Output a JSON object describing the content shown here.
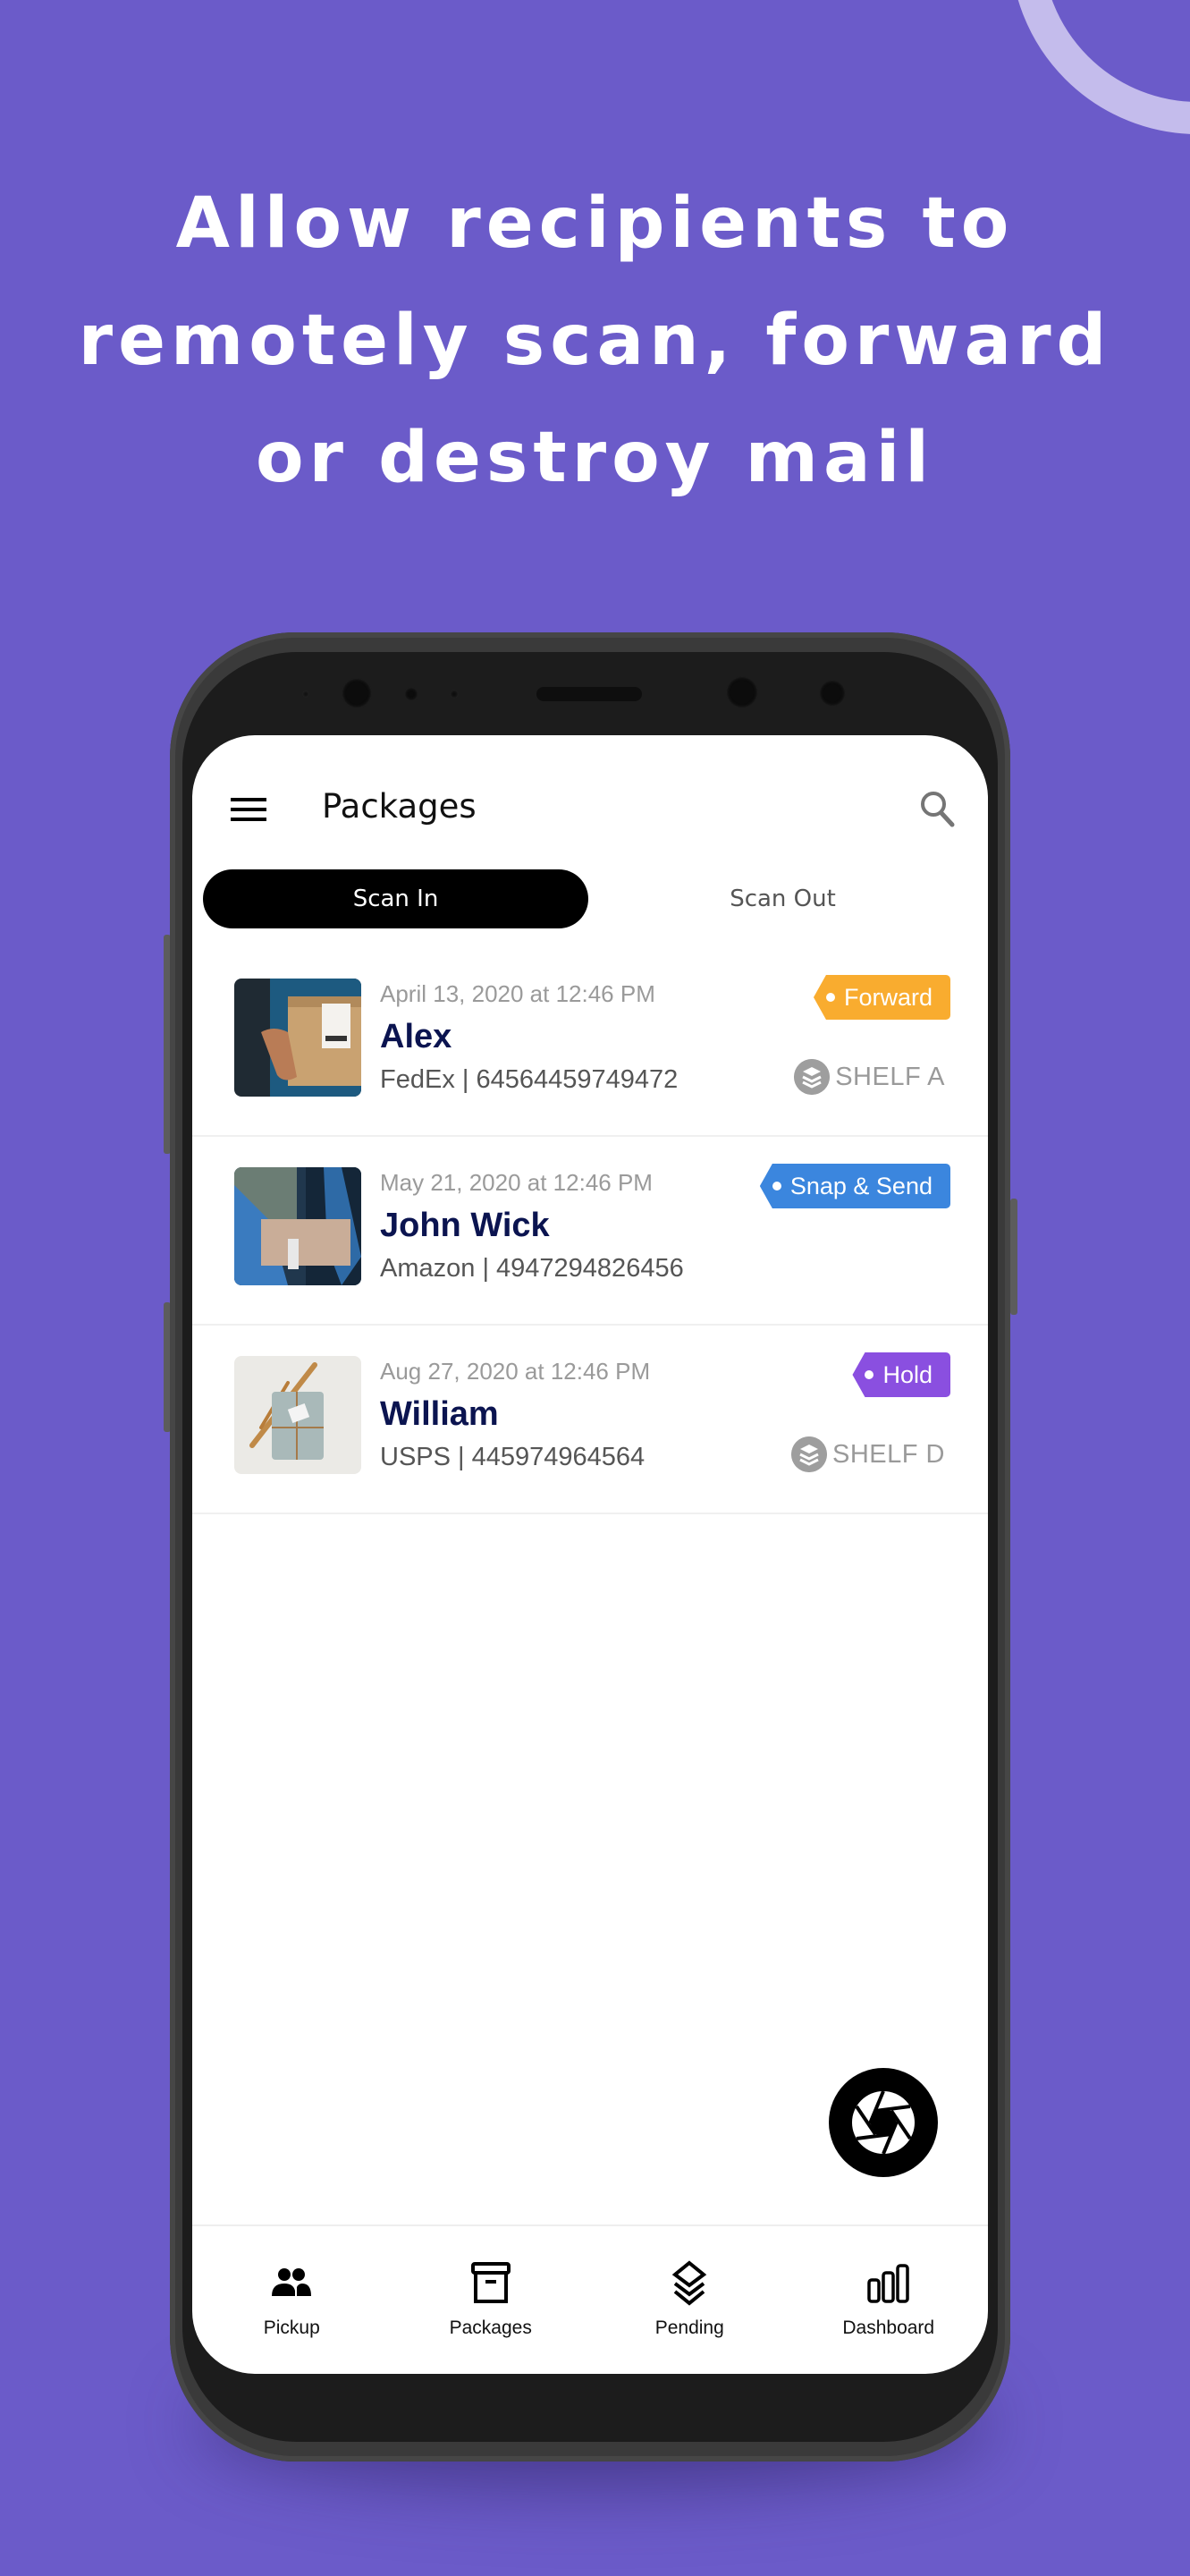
{
  "headline": {
    "lines": [
      "Allow recipients to",
      "remotely scan, forward",
      "or destroy mail"
    ]
  },
  "colors": {
    "background": "#6B5BC9",
    "accent_ring": "#C4BCEC",
    "name_text": "#0B1450",
    "badge_forward": "#F9AC2F",
    "badge_snap_send": "#3B86DE",
    "badge_hold": "#8A4FE0"
  },
  "app": {
    "title": "Packages",
    "menu_icon": "hamburger-menu-icon",
    "search_icon": "search-icon",
    "tabs": [
      {
        "label": "Scan In",
        "active": true
      },
      {
        "label": "Scan Out",
        "active": false
      }
    ],
    "packages": [
      {
        "date": "April 13, 2020 at 12:46 PM",
        "name": "Alex",
        "carrier_tracking": "FedEx | 64564459749472",
        "status": "Forward",
        "status_color": "#F9AC2F",
        "shelf": "SHELF A",
        "thumbnail": "person-holding-box-photo"
      },
      {
        "date": "May 21, 2020 at 12:46 PM",
        "name": "John Wick",
        "carrier_tracking": "Amazon | 4947294826456",
        "status": "Snap & Send",
        "status_color": "#3B86DE",
        "shelf": "",
        "thumbnail": "package-handoff-photo"
      },
      {
        "date": "Aug 27, 2020 at 12:46 PM",
        "name": "William",
        "carrier_tracking": "USPS | 445974964564",
        "status": "Hold",
        "status_color": "#8A4FE0",
        "shelf": "SHELF D",
        "thumbnail": "wrapped-parcel-photo"
      }
    ],
    "fab_icon": "camera-shutter-icon",
    "bottom_nav": [
      {
        "label": "Pickup",
        "icon": "people-icon"
      },
      {
        "label": "Packages",
        "icon": "archive-box-icon"
      },
      {
        "label": "Pending",
        "icon": "layers-icon"
      },
      {
        "label": "Dashboard",
        "icon": "bar-chart-icon"
      }
    ]
  }
}
